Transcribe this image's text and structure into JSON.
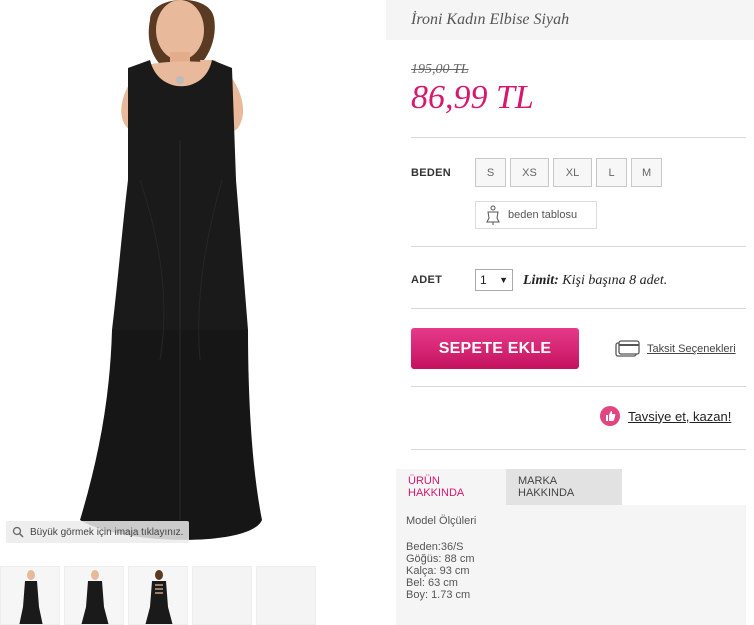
{
  "product": {
    "title": "İroni Kadın Elbise Siyah",
    "old_price": "195,00 TL",
    "new_price": "86,99 TL"
  },
  "gallery": {
    "zoom_hint": "Büyük görmek için imaja tıklayınız.",
    "thumbnails": [
      "front",
      "front-pose",
      "back"
    ]
  },
  "size": {
    "label": "BEDEN",
    "options": [
      "S",
      "XS",
      "XL",
      "L",
      "M"
    ],
    "size_table_label": "beden tablosu"
  },
  "quantity": {
    "label": "ADET",
    "value": "1",
    "limit_label": "Limit:",
    "limit_text": " Kişi başına 8 adet."
  },
  "actions": {
    "add_to_cart": "SEPETE EKLE",
    "installments": "Taksit Seçenekleri",
    "recommend": "Tavsiye et, kazan!"
  },
  "tabs": {
    "items": [
      "ÜRÜN HAKKINDA",
      "MARKA HAKKINDA"
    ],
    "active_index": 0,
    "content_heading": "Model Ölçüleri",
    "measurements": [
      "Beden:36/S",
      "Göğüs: 88 cm",
      "Kalça: 93 cm",
      "Bel: 63 cm",
      "Boy: 1.73 cm"
    ]
  },
  "colors": {
    "accent": "#d6186f",
    "dress": "#1a1a1a",
    "skin": "#e8b99a",
    "hair": "#5a3a22"
  }
}
